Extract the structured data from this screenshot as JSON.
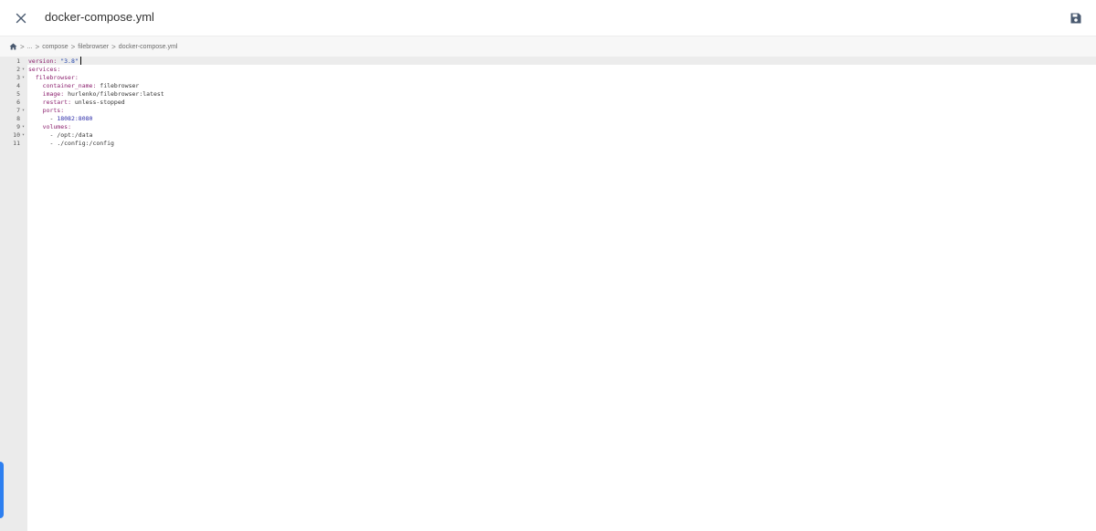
{
  "header": {
    "title": "docker-compose.yml",
    "close_icon": "close-icon",
    "save_icon": "save-icon"
  },
  "breadcrumb": {
    "home_icon": "home-icon",
    "items": [
      "...",
      "compose",
      "filebrowser",
      "docker-compose.yml"
    ],
    "separator": ">"
  },
  "editor": {
    "active_line": 1,
    "lines": [
      {
        "num": "1",
        "fold": "",
        "key": "version",
        "sep": ": ",
        "value": "\"3.8\"",
        "vclass": "s",
        "indent": ""
      },
      {
        "num": "2",
        "fold": "▾",
        "key": "services",
        "sep": ":",
        "value": "",
        "vclass": "p",
        "indent": ""
      },
      {
        "num": "3",
        "fold": "▾",
        "key": "filebrowser",
        "sep": ":",
        "value": "",
        "vclass": "p",
        "indent": "  "
      },
      {
        "num": "4",
        "fold": "",
        "key": "container_name",
        "sep": ": ",
        "value": "filebrowser",
        "vclass": "p",
        "indent": "    "
      },
      {
        "num": "5",
        "fold": "",
        "key": "image",
        "sep": ": ",
        "value": "hurlenko/filebrowser:latest",
        "vclass": "p",
        "indent": "    "
      },
      {
        "num": "6",
        "fold": "",
        "key": "restart",
        "sep": ": ",
        "value": "unless-stopped",
        "vclass": "p",
        "indent": "    "
      },
      {
        "num": "7",
        "fold": "▾",
        "key": "ports",
        "sep": ":",
        "value": "",
        "vclass": "p",
        "indent": "    "
      },
      {
        "num": "8",
        "fold": "",
        "key": "",
        "sep": "- ",
        "value": "18082:8080",
        "vclass": "n",
        "indent": "      "
      },
      {
        "num": "9",
        "fold": "▾",
        "key": "volumes",
        "sep": ":",
        "value": "",
        "vclass": "p",
        "indent": "    "
      },
      {
        "num": "10",
        "fold": "▾",
        "key": "",
        "sep": "- ",
        "value": "/opt:/data",
        "vclass": "p",
        "indent": "      "
      },
      {
        "num": "11",
        "fold": "",
        "key": "",
        "sep": "- ",
        "value": "./config:/config",
        "vclass": "p",
        "indent": "      "
      }
    ]
  },
  "colors": {
    "accent": "#2d7ff0",
    "key": "#8b1f6d",
    "string": "#1a3ea8"
  }
}
